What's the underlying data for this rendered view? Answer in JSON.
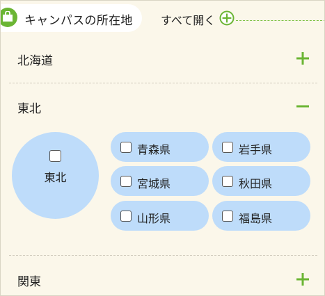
{
  "header": {
    "title": "キャンパスの所在地",
    "open_all_label": "すべて開く",
    "accent_color": "#6bb534"
  },
  "regions": [
    {
      "label": "北海道",
      "expanded": false,
      "toggle_icon": "plus-icon"
    },
    {
      "label": "東北",
      "expanded": true,
      "toggle_icon": "minus-icon",
      "select_all_label": "東北",
      "select_all_checked": false,
      "prefectures": [
        {
          "label": "青森県",
          "checked": false
        },
        {
          "label": "岩手県",
          "checked": false
        },
        {
          "label": "宮城県",
          "checked": false
        },
        {
          "label": "秋田県",
          "checked": false
        },
        {
          "label": "山形県",
          "checked": false
        },
        {
          "label": "福島県",
          "checked": false
        }
      ]
    },
    {
      "label": "関東",
      "expanded": false,
      "toggle_icon": "plus-icon"
    }
  ],
  "colors": {
    "panel_bg": "#fbf7ea",
    "chip_bg": "#bedcfa",
    "accent": "#6bb534"
  }
}
